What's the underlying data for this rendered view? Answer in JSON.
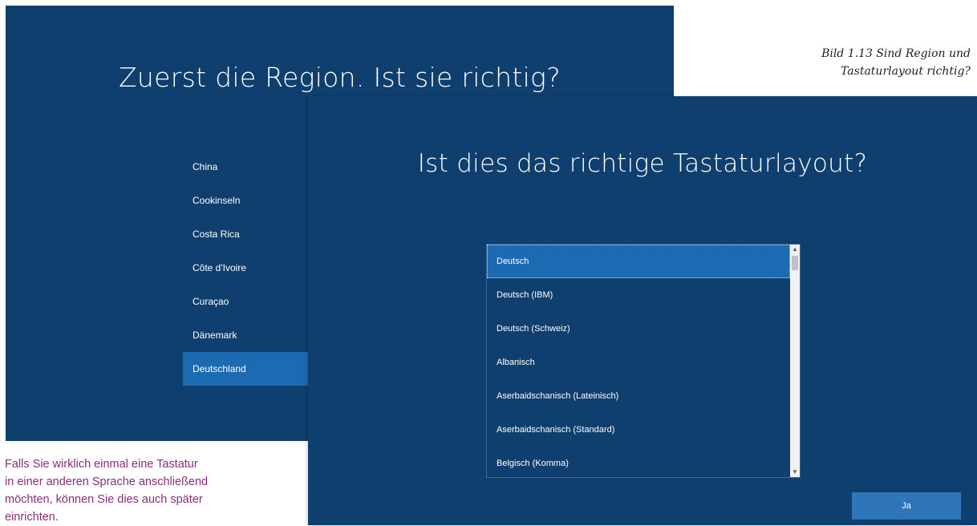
{
  "region_screen": {
    "title": "Zuerst die Region. Ist sie richtig?",
    "items": [
      {
        "label": "China"
      },
      {
        "label": "Cookinseln"
      },
      {
        "label": "Costa Rica"
      },
      {
        "label": "Côte d'Ivoire"
      },
      {
        "label": "Curaçao"
      },
      {
        "label": "Dänemark"
      },
      {
        "label": "Deutschland",
        "selected": true
      }
    ]
  },
  "keyboard_screen": {
    "title": "Ist dies das richtige Tastaturlayout?",
    "items": [
      {
        "label": "Deutsch",
        "selected": true
      },
      {
        "label": "Deutsch (IBM)"
      },
      {
        "label": "Deutsch (Schweiz)"
      },
      {
        "label": "Albanisch"
      },
      {
        "label": "Aserbaidschanisch (Lateinisch)"
      },
      {
        "label": "Aserbaidschanisch (Standard)"
      },
      {
        "label": "Belgisch (Komma)"
      }
    ],
    "confirm_button": "Ja",
    "scroll_up_icon": "▲",
    "scroll_down_icon": "▼"
  },
  "caption": {
    "line1": "Bild 1.13 Sind Region und",
    "line2": "Tastaturlayout richtig?"
  },
  "side_text": {
    "line1": "Falls Sie wirklich einmal eine Tastatur",
    "line2": "in einer anderen Sprache anschließend",
    "line3": "möchten, können Sie dies auch später",
    "line4": "einrichten."
  },
  "colors": {
    "panel_bg": "#0f3f6e",
    "selected_bg": "#1c6ab1",
    "button_bg": "#2e75b9",
    "side_text": "#8b2d7e"
  }
}
